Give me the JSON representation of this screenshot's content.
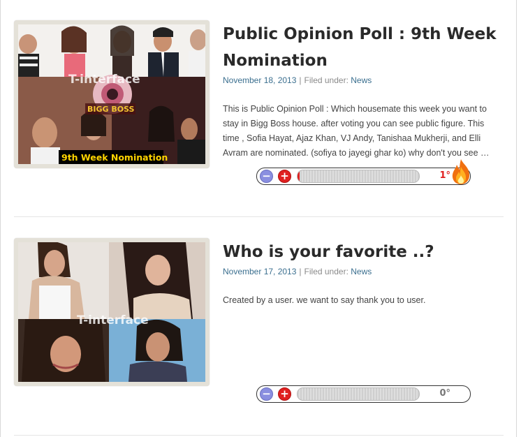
{
  "posts": [
    {
      "title": "Public Opinion Poll : 9th Week Nomination",
      "date": "November 18, 2013",
      "filed_label": "Filed under:",
      "category": "News",
      "excerpt": "This is Public Opinion Poll : Which housemate this week you want to stay in Bigg Boss house. after voting you can see public figure. This time , Sofia Hayat, Ajaz Khan, VJ Andy, Tanishaa Mukherji, and Elli Avram are nominated. (sofiya to jayegi ghar ko) why don't you see …",
      "thumbnail": {
        "watermark": "T-interface",
        "logo_text": "BIGG BOSS",
        "banner": "9th Week Nomination"
      },
      "rating": {
        "minus": "−",
        "plus": "+",
        "value": "1°",
        "fill": 0.01,
        "hot": true
      }
    },
    {
      "title": "Who is your favorite ..?",
      "date": "November 17, 2013",
      "filed_label": "Filed under:",
      "category": "News",
      "excerpt": "Created by a user. we want to say thank you to user.",
      "thumbnail": {
        "watermark": "T-interface"
      },
      "rating": {
        "minus": "−",
        "plus": "+",
        "value": "0°",
        "fill": 0,
        "hot": false
      }
    }
  ],
  "colors": {
    "link": "#3b6f8f",
    "title": "#2a2a2a",
    "hot": "#e02020",
    "minus": "#8a8fe0"
  }
}
